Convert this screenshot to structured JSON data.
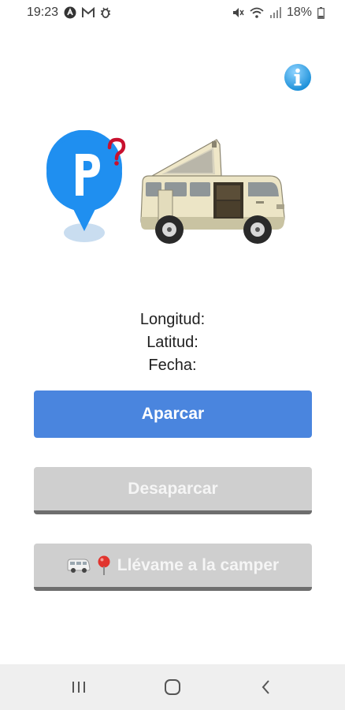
{
  "status_bar": {
    "time": "19:23",
    "battery_percent": "18%",
    "left_icons": [
      "notification-a-icon",
      "mail-icon",
      "bug-icon"
    ],
    "right_icons": [
      "mute-icon",
      "wifi-icon",
      "signal-icon",
      "battery-icon"
    ]
  },
  "header": {
    "info_icon": "info-icon"
  },
  "hero": {
    "parking_icon": "parking-pin-icon",
    "van_image": "camper-van-illustration"
  },
  "location": {
    "longitude_label": "Longitud:",
    "latitude_label": "Latitud:",
    "date_label": "Fecha:"
  },
  "buttons": {
    "park_label": "Aparcar",
    "unpark_label": "Desaparcar",
    "navigate_label": "Llévame a la camper",
    "navigate_icons": [
      "van-emoji-icon",
      "pin-emoji-icon"
    ]
  },
  "nav_bar": {
    "items": [
      "recent-apps-icon",
      "home-icon",
      "back-icon"
    ]
  },
  "colors": {
    "primary_button": "#4a85de",
    "disabled_button": "#cfcfcf",
    "pin_blue": "#1f8ff0",
    "question_red": "#c8102e",
    "van_cream": "#ece5c6"
  }
}
